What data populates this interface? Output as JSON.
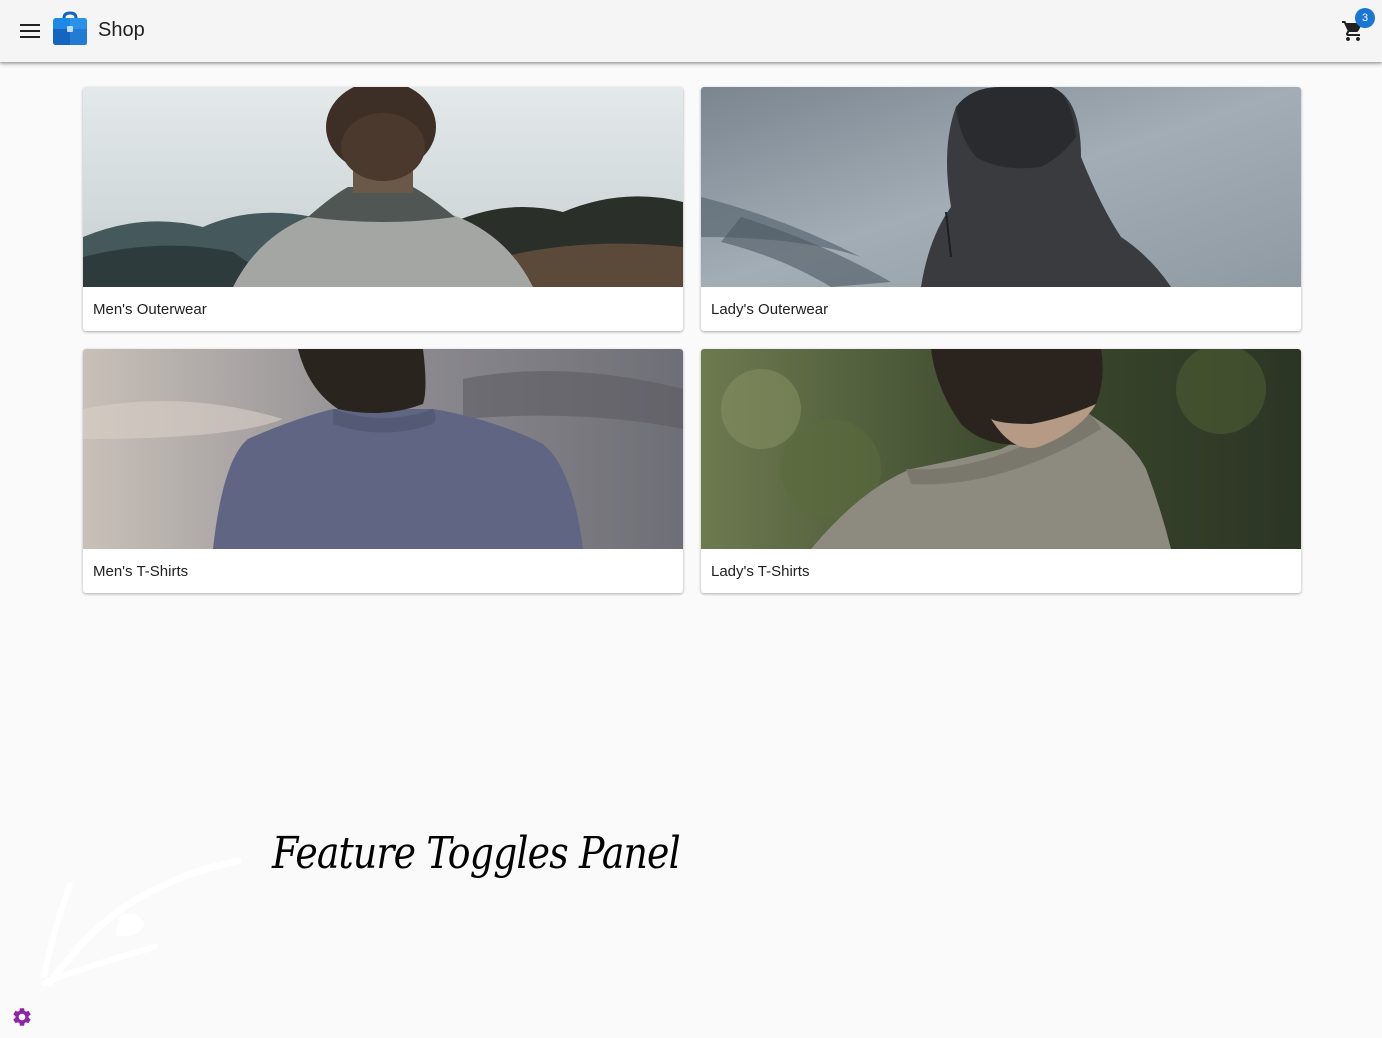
{
  "app": {
    "title": "Shop",
    "logo_icon": "shopping-bag-icon",
    "logo_color": "#1e88e5"
  },
  "header": {
    "menu_icon": "menu-icon",
    "cart_icon": "cart-icon",
    "cart_count": "3",
    "badge_color": "#1976d2"
  },
  "categories": [
    {
      "label": "Men's Outerwear"
    },
    {
      "label": "Lady's Outerwear"
    },
    {
      "label": "Men's T-Shirts"
    },
    {
      "label": "Lady's T-Shirts"
    }
  ],
  "feature_panel": {
    "title": "Feature Toggles Panel",
    "settings_icon": "gear-icon",
    "settings_color": "#8e24aa"
  }
}
